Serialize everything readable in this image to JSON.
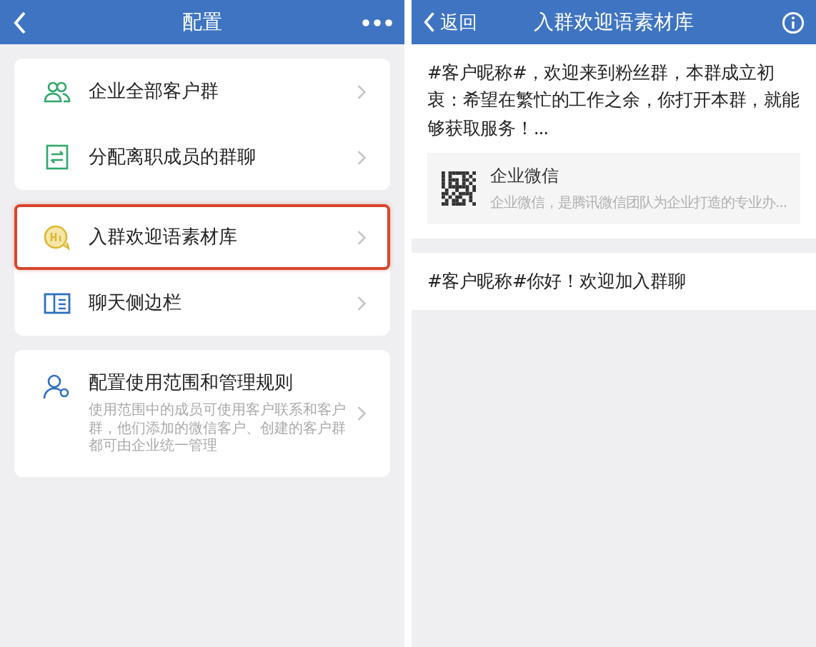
{
  "left_screen": {
    "header": {
      "title": "配置"
    },
    "groups": [
      {
        "items": [
          {
            "label": "企业全部客户群",
            "highlighted": false
          },
          {
            "label": "分配离职成员的群聊",
            "highlighted": false
          }
        ]
      },
      {
        "items": [
          {
            "label": "入群欢迎语素材库",
            "highlighted": true
          },
          {
            "label": "聊天侧边栏",
            "highlighted": false
          }
        ]
      },
      {
        "items": [
          {
            "label": "配置使用范围和管理规则",
            "description": "使用范围中的成员可使用客户联系和客户群，他们添加的微信客户、创建的客户群都可由企业统一管理",
            "highlighted": false
          }
        ]
      }
    ]
  },
  "right_screen": {
    "header": {
      "back": "返回",
      "title": "入群欢迎语素材库"
    },
    "messages": [
      {
        "text": "#客户昵称#，欢迎来到粉丝群，本群成立初衷：希望在繁忙的工作之余，你打开本群，就能够获取服务！...",
        "link": {
          "title": "企业微信",
          "description": "企业微信，是腾讯微信团队为企业打造的专业办..."
        }
      },
      {
        "text": "#客户昵称#你好！欢迎加入群聊"
      }
    ]
  }
}
